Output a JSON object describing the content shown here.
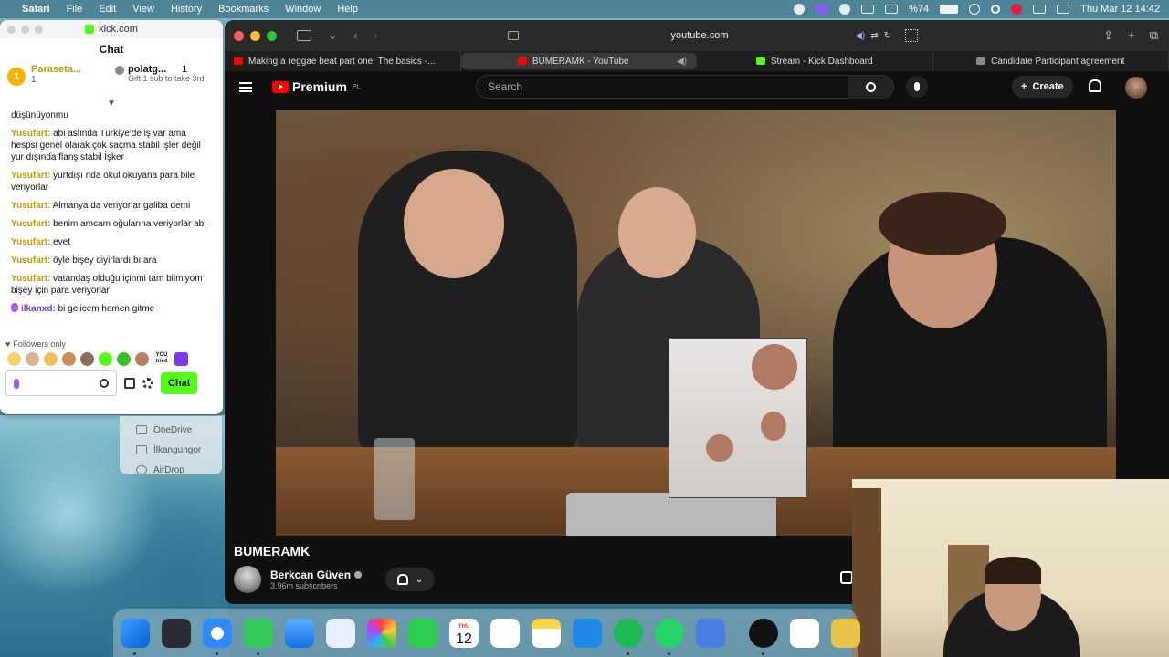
{
  "menubar": {
    "app": "Safari",
    "items": [
      "File",
      "Edit",
      "View",
      "History",
      "Bookmarks",
      "Window",
      "Help"
    ],
    "battery": "%74",
    "clock": "Thu Mar 12  14:42"
  },
  "kick_window": {
    "title": "kick.com",
    "header": "Chat",
    "leaders": {
      "first_name": "Paraseta...",
      "first_rank": "1",
      "first_count": "1",
      "second_name": "polatg...",
      "second_count": "1",
      "gift_text": "Gift 1 sub to take 3rd"
    },
    "messages": [
      {
        "user": "",
        "text": "düşünüyonmu"
      },
      {
        "user": "Yusufart:",
        "text": "abi aslında Türkiye'de iş var ama hespsi genel olarak çok saçma stabil işler değil yur dışında flanş stabil İşker"
      },
      {
        "user": "Yusufart:",
        "text": "yurtdışı nda okul okuyana para bile veriyorlar"
      },
      {
        "user": "Yusufart:",
        "text": "Almanya da veriyorlar galiba demi"
      },
      {
        "user": "Yusufart:",
        "text": "benim amcam oğularına veriyorlar abi"
      },
      {
        "user": "Yusufart:",
        "text": "evet"
      },
      {
        "user": "Yusufart:",
        "text": "öyle bişey diyirlardı bı ara"
      },
      {
        "user": "Yusufart:",
        "text": "vatandaş olduğu içinmi tam bilmiyom bişey için para veriyorlar"
      },
      {
        "user": "ilkanxd:",
        "text": "bi gelicem hemen gitme"
      }
    ],
    "followers_only": "Followers only",
    "emote_tag": "YOU tried",
    "chat_button": "Chat"
  },
  "finder": {
    "items": [
      "OneDrive",
      "İlkangungor",
      "AirDrop"
    ]
  },
  "safari": {
    "url": "youtube.com",
    "tabs": [
      {
        "title": "Making a reggae beat part one: The basics -...",
        "color": "#ff0000"
      },
      {
        "title": "BUMERAMK - YouTube",
        "color": "#ff0000"
      },
      {
        "title": "Stream - Kick Dashboard",
        "color": "#53fc18"
      },
      {
        "title": "Candidate Participant agreement",
        "color": "#888888"
      }
    ]
  },
  "youtube": {
    "logo_text": "Premium",
    "region": "PL",
    "search_placeholder": "Search",
    "create_label": "Create",
    "video_title": "BUMERAMK",
    "channel_name": "Berkcan Güven",
    "subscribers": "3.96m subscribers"
  },
  "dock": {
    "calendar_day": "12",
    "calendar_month": "THU"
  }
}
